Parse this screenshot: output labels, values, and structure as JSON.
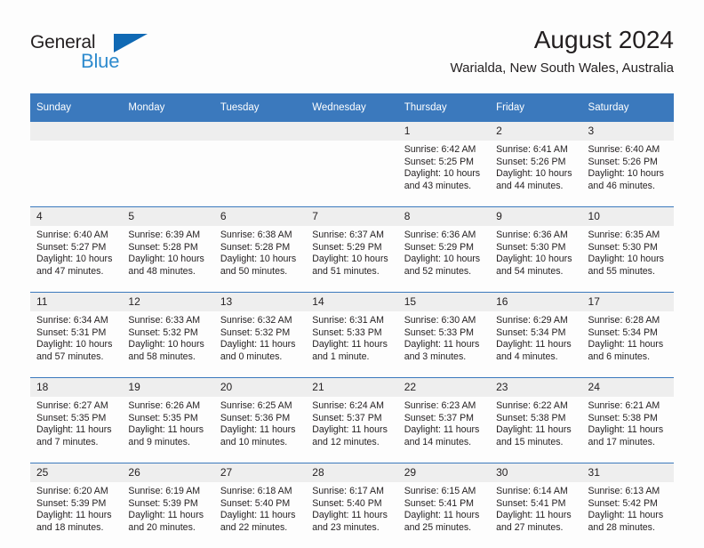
{
  "brand": {
    "name_part1": "General",
    "name_part2": "Blue",
    "flag_icon": "triangle-flag-icon"
  },
  "header": {
    "title": "August 2024",
    "subtitle": "Warialda, New South Wales, Australia"
  },
  "colors": {
    "header_blue": "#3b79bd",
    "brand_blue": "#2e8bce",
    "flag_blue": "#1069b4",
    "daynum_band": "#eeeeee",
    "text": "#231f20",
    "page_bg": "#fdfdfd"
  },
  "weekday_headers": [
    "Sunday",
    "Monday",
    "Tuesday",
    "Wednesday",
    "Thursday",
    "Friday",
    "Saturday"
  ],
  "weeks": [
    [
      {
        "day": "",
        "blank": true,
        "sunrise": "",
        "sunset": "",
        "daylight1": "",
        "daylight2": ""
      },
      {
        "day": "",
        "blank": true,
        "sunrise": "",
        "sunset": "",
        "daylight1": "",
        "daylight2": ""
      },
      {
        "day": "",
        "blank": true,
        "sunrise": "",
        "sunset": "",
        "daylight1": "",
        "daylight2": ""
      },
      {
        "day": "",
        "blank": true,
        "sunrise": "",
        "sunset": "",
        "daylight1": "",
        "daylight2": ""
      },
      {
        "day": "1",
        "blank": false,
        "sunrise": "Sunrise: 6:42 AM",
        "sunset": "Sunset: 5:25 PM",
        "daylight1": "Daylight: 10 hours",
        "daylight2": "and 43 minutes."
      },
      {
        "day": "2",
        "blank": false,
        "sunrise": "Sunrise: 6:41 AM",
        "sunset": "Sunset: 5:26 PM",
        "daylight1": "Daylight: 10 hours",
        "daylight2": "and 44 minutes."
      },
      {
        "day": "3",
        "blank": false,
        "sunrise": "Sunrise: 6:40 AM",
        "sunset": "Sunset: 5:26 PM",
        "daylight1": "Daylight: 10 hours",
        "daylight2": "and 46 minutes."
      }
    ],
    [
      {
        "day": "4",
        "blank": false,
        "sunrise": "Sunrise: 6:40 AM",
        "sunset": "Sunset: 5:27 PM",
        "daylight1": "Daylight: 10 hours",
        "daylight2": "and 47 minutes."
      },
      {
        "day": "5",
        "blank": false,
        "sunrise": "Sunrise: 6:39 AM",
        "sunset": "Sunset: 5:28 PM",
        "daylight1": "Daylight: 10 hours",
        "daylight2": "and 48 minutes."
      },
      {
        "day": "6",
        "blank": false,
        "sunrise": "Sunrise: 6:38 AM",
        "sunset": "Sunset: 5:28 PM",
        "daylight1": "Daylight: 10 hours",
        "daylight2": "and 50 minutes."
      },
      {
        "day": "7",
        "blank": false,
        "sunrise": "Sunrise: 6:37 AM",
        "sunset": "Sunset: 5:29 PM",
        "daylight1": "Daylight: 10 hours",
        "daylight2": "and 51 minutes."
      },
      {
        "day": "8",
        "blank": false,
        "sunrise": "Sunrise: 6:36 AM",
        "sunset": "Sunset: 5:29 PM",
        "daylight1": "Daylight: 10 hours",
        "daylight2": "and 52 minutes."
      },
      {
        "day": "9",
        "blank": false,
        "sunrise": "Sunrise: 6:36 AM",
        "sunset": "Sunset: 5:30 PM",
        "daylight1": "Daylight: 10 hours",
        "daylight2": "and 54 minutes."
      },
      {
        "day": "10",
        "blank": false,
        "sunrise": "Sunrise: 6:35 AM",
        "sunset": "Sunset: 5:30 PM",
        "daylight1": "Daylight: 10 hours",
        "daylight2": "and 55 minutes."
      }
    ],
    [
      {
        "day": "11",
        "blank": false,
        "sunrise": "Sunrise: 6:34 AM",
        "sunset": "Sunset: 5:31 PM",
        "daylight1": "Daylight: 10 hours",
        "daylight2": "and 57 minutes."
      },
      {
        "day": "12",
        "blank": false,
        "sunrise": "Sunrise: 6:33 AM",
        "sunset": "Sunset: 5:32 PM",
        "daylight1": "Daylight: 10 hours",
        "daylight2": "and 58 minutes."
      },
      {
        "day": "13",
        "blank": false,
        "sunrise": "Sunrise: 6:32 AM",
        "sunset": "Sunset: 5:32 PM",
        "daylight1": "Daylight: 11 hours",
        "daylight2": "and 0 minutes."
      },
      {
        "day": "14",
        "blank": false,
        "sunrise": "Sunrise: 6:31 AM",
        "sunset": "Sunset: 5:33 PM",
        "daylight1": "Daylight: 11 hours",
        "daylight2": "and 1 minute."
      },
      {
        "day": "15",
        "blank": false,
        "sunrise": "Sunrise: 6:30 AM",
        "sunset": "Sunset: 5:33 PM",
        "daylight1": "Daylight: 11 hours",
        "daylight2": "and 3 minutes."
      },
      {
        "day": "16",
        "blank": false,
        "sunrise": "Sunrise: 6:29 AM",
        "sunset": "Sunset: 5:34 PM",
        "daylight1": "Daylight: 11 hours",
        "daylight2": "and 4 minutes."
      },
      {
        "day": "17",
        "blank": false,
        "sunrise": "Sunrise: 6:28 AM",
        "sunset": "Sunset: 5:34 PM",
        "daylight1": "Daylight: 11 hours",
        "daylight2": "and 6 minutes."
      }
    ],
    [
      {
        "day": "18",
        "blank": false,
        "sunrise": "Sunrise: 6:27 AM",
        "sunset": "Sunset: 5:35 PM",
        "daylight1": "Daylight: 11 hours",
        "daylight2": "and 7 minutes."
      },
      {
        "day": "19",
        "blank": false,
        "sunrise": "Sunrise: 6:26 AM",
        "sunset": "Sunset: 5:35 PM",
        "daylight1": "Daylight: 11 hours",
        "daylight2": "and 9 minutes."
      },
      {
        "day": "20",
        "blank": false,
        "sunrise": "Sunrise: 6:25 AM",
        "sunset": "Sunset: 5:36 PM",
        "daylight1": "Daylight: 11 hours",
        "daylight2": "and 10 minutes."
      },
      {
        "day": "21",
        "blank": false,
        "sunrise": "Sunrise: 6:24 AM",
        "sunset": "Sunset: 5:37 PM",
        "daylight1": "Daylight: 11 hours",
        "daylight2": "and 12 minutes."
      },
      {
        "day": "22",
        "blank": false,
        "sunrise": "Sunrise: 6:23 AM",
        "sunset": "Sunset: 5:37 PM",
        "daylight1": "Daylight: 11 hours",
        "daylight2": "and 14 minutes."
      },
      {
        "day": "23",
        "blank": false,
        "sunrise": "Sunrise: 6:22 AM",
        "sunset": "Sunset: 5:38 PM",
        "daylight1": "Daylight: 11 hours",
        "daylight2": "and 15 minutes."
      },
      {
        "day": "24",
        "blank": false,
        "sunrise": "Sunrise: 6:21 AM",
        "sunset": "Sunset: 5:38 PM",
        "daylight1": "Daylight: 11 hours",
        "daylight2": "and 17 minutes."
      }
    ],
    [
      {
        "day": "25",
        "blank": false,
        "sunrise": "Sunrise: 6:20 AM",
        "sunset": "Sunset: 5:39 PM",
        "daylight1": "Daylight: 11 hours",
        "daylight2": "and 18 minutes."
      },
      {
        "day": "26",
        "blank": false,
        "sunrise": "Sunrise: 6:19 AM",
        "sunset": "Sunset: 5:39 PM",
        "daylight1": "Daylight: 11 hours",
        "daylight2": "and 20 minutes."
      },
      {
        "day": "27",
        "blank": false,
        "sunrise": "Sunrise: 6:18 AM",
        "sunset": "Sunset: 5:40 PM",
        "daylight1": "Daylight: 11 hours",
        "daylight2": "and 22 minutes."
      },
      {
        "day": "28",
        "blank": false,
        "sunrise": "Sunrise: 6:17 AM",
        "sunset": "Sunset: 5:40 PM",
        "daylight1": "Daylight: 11 hours",
        "daylight2": "and 23 minutes."
      },
      {
        "day": "29",
        "blank": false,
        "sunrise": "Sunrise: 6:15 AM",
        "sunset": "Sunset: 5:41 PM",
        "daylight1": "Daylight: 11 hours",
        "daylight2": "and 25 minutes."
      },
      {
        "day": "30",
        "blank": false,
        "sunrise": "Sunrise: 6:14 AM",
        "sunset": "Sunset: 5:41 PM",
        "daylight1": "Daylight: 11 hours",
        "daylight2": "and 27 minutes."
      },
      {
        "day": "31",
        "blank": false,
        "sunrise": "Sunrise: 6:13 AM",
        "sunset": "Sunset: 5:42 PM",
        "daylight1": "Daylight: 11 hours",
        "daylight2": "and 28 minutes."
      }
    ]
  ]
}
